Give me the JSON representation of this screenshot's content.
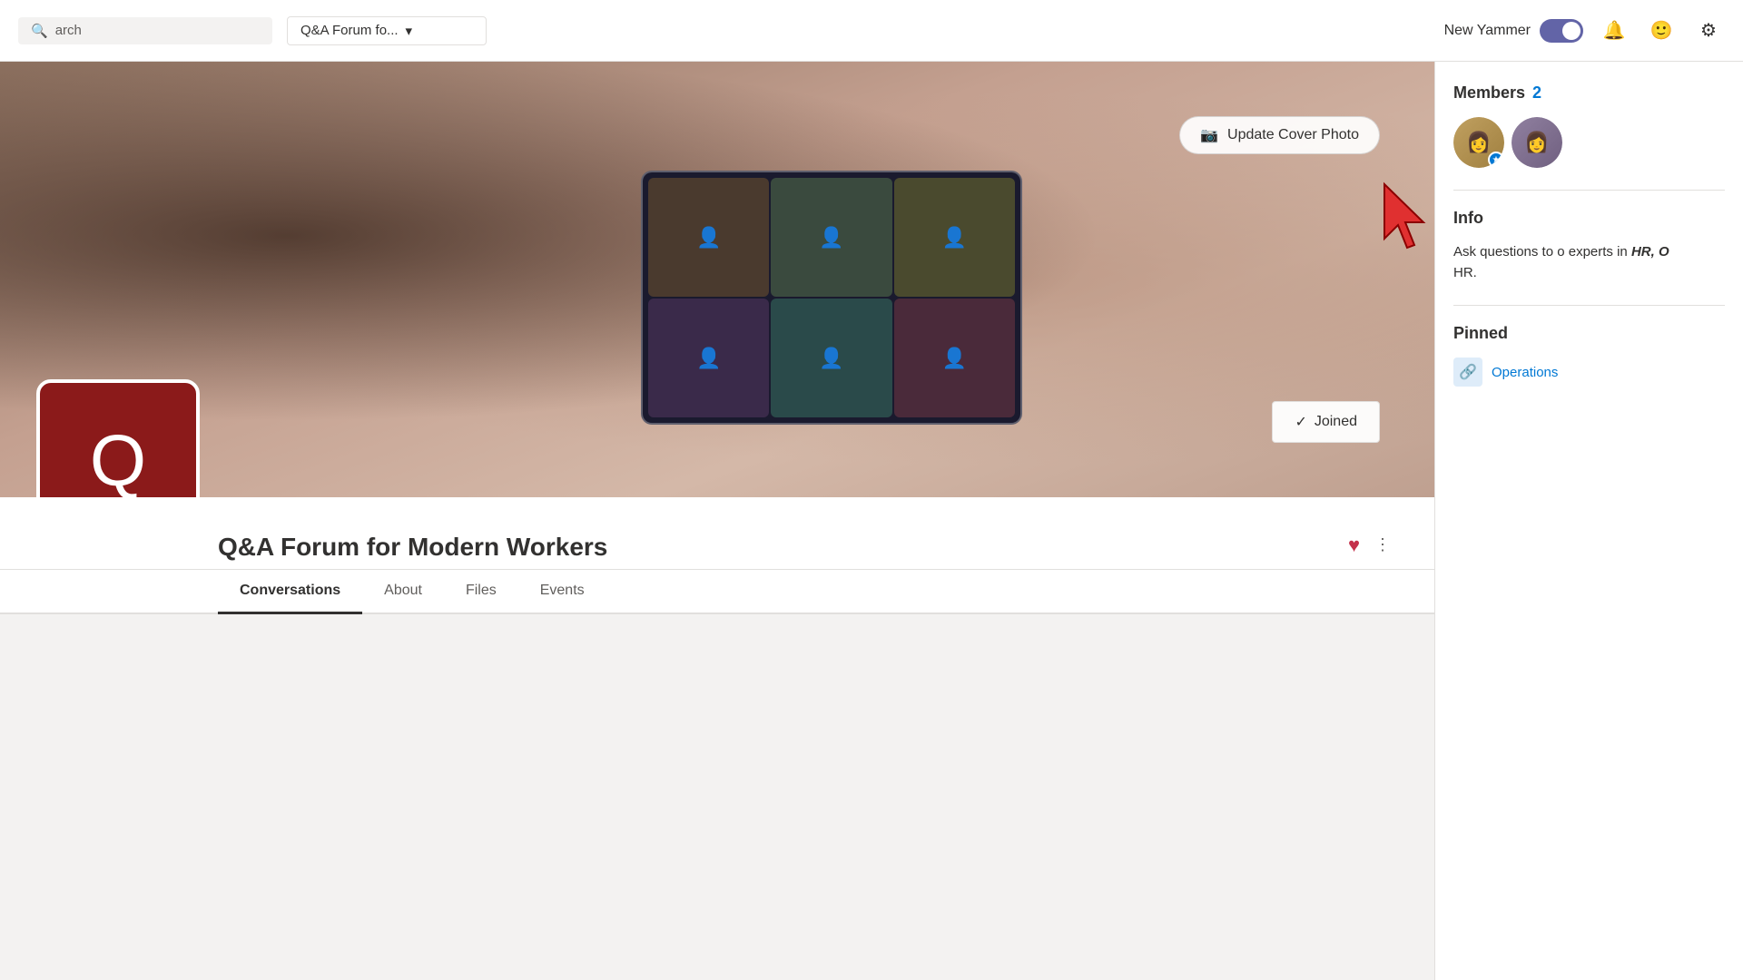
{
  "header": {
    "search_placeholder": "arch",
    "dropdown_label": "Q&A Forum fo...",
    "new_yammer_label": "New Yammer",
    "toggle_on": true,
    "bell_icon": "🔔",
    "emoji_icon": "🙂",
    "gear_icon": "⚙"
  },
  "cover": {
    "update_cover_label": "Update Cover Photo",
    "camera_icon": "📷",
    "joined_label": "Joined",
    "checkmark": "✓",
    "group_letter": "Q"
  },
  "group": {
    "title": "Q&A Forum for Modern Workers",
    "like_icon": "♥",
    "more_icon": "⋮"
  },
  "nav_tabs": [
    {
      "label": "Conversations",
      "active": true
    },
    {
      "label": "About",
      "active": false
    },
    {
      "label": "Files",
      "active": false
    },
    {
      "label": "Events",
      "active": false
    }
  ],
  "sidebar": {
    "members_title": "Members",
    "members_count": "2",
    "info_title": "Info",
    "info_text": "Ask questions to o experts in ",
    "info_italic": "HR, O",
    "info_end": "HR.",
    "pinned_title": "Pinned",
    "pinned_item_label": "Operations"
  }
}
